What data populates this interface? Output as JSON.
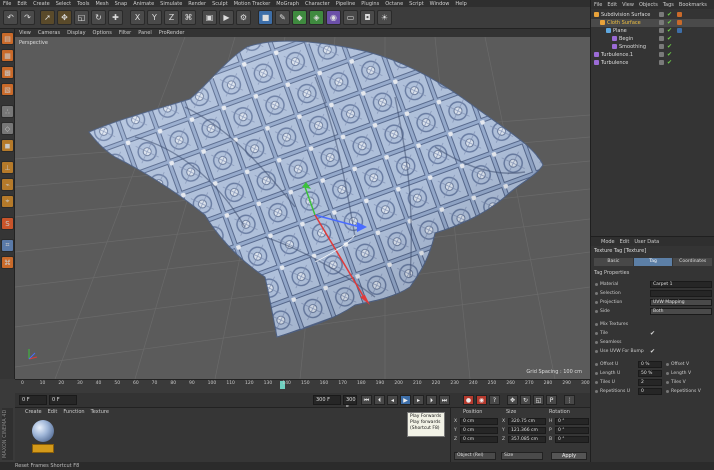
{
  "menubar": [
    "File",
    "Edit",
    "Create",
    "Select",
    "Tools",
    "Mesh",
    "Snap",
    "Animate",
    "Simulate",
    "Render",
    "Sculpt",
    "Motion Tracker",
    "MoGraph",
    "Character",
    "Pipeline",
    "Plugins",
    "Octane",
    "Script",
    "Window",
    "Help"
  ],
  "viewport_menu": [
    "View",
    "Cameras",
    "Display",
    "Options",
    "Filter",
    "Panel",
    "ProRender"
  ],
  "viewport": {
    "label": "Perspective",
    "grid_spacing": "Grid Spacing : 100 cm"
  },
  "timeline": {
    "ticks": [
      "0",
      "10",
      "20",
      "30",
      "40",
      "50",
      "60",
      "70",
      "80",
      "90",
      "100",
      "110",
      "120",
      "130",
      "140",
      "150",
      "160",
      "170",
      "180",
      "190",
      "200",
      "210",
      "220",
      "230",
      "240",
      "250",
      "260",
      "270",
      "280",
      "290",
      "300"
    ],
    "current_frame": "140",
    "end_label": "300 F"
  },
  "transport": {
    "start": "0 F",
    "current": "0 F",
    "end": "300 F",
    "end2": "300 F"
  },
  "tooltip": {
    "title": "Play Forwards",
    "line1": "Play forwards",
    "line2": "(Shortcut F8)"
  },
  "material_manager": {
    "menu": [
      "Create",
      "Edit",
      "Function",
      "Texture"
    ]
  },
  "coordinates": {
    "headers": [
      "Position",
      "Size",
      "Rotation"
    ],
    "rows": [
      {
        "axis": "X",
        "pos": "0 cm",
        "size_axis": "X",
        "size": "320.75 cm",
        "rot_axis": "H",
        "rot": "0 °"
      },
      {
        "axis": "Y",
        "pos": "0 cm",
        "size_axis": "Y",
        "size": "121.366 cm",
        "rot_axis": "P",
        "rot": "0 °"
      },
      {
        "axis": "Z",
        "pos": "0 cm",
        "size_axis": "Z",
        "size": "357.085 cm",
        "rot_axis": "B",
        "rot": "0 °"
      }
    ],
    "mode": "Object (Rel)",
    "size_mode": "Size",
    "apply": "Apply"
  },
  "object_manager": {
    "menu": [
      "File",
      "Edit",
      "View",
      "Objects",
      "Tags",
      "Bookmarks"
    ],
    "items": [
      {
        "name": "Subdivision Surface",
        "indent": 0,
        "color": "#e8a23a"
      },
      {
        "name": "Cloth Surface",
        "indent": 1,
        "color": "#e8a23a"
      },
      {
        "name": "Plane",
        "indent": 2,
        "color": "#5fa8e0"
      },
      {
        "name": "Begin",
        "indent": 3,
        "color": "#9b6bd6"
      },
      {
        "name": "Smoothing",
        "indent": 3,
        "color": "#9b6bd6"
      },
      {
        "name": "Turbulence.1",
        "indent": 0,
        "color": "#9b6bd6"
      },
      {
        "name": "Turbulence",
        "indent": 0,
        "color": "#9b6bd6"
      }
    ]
  },
  "attributes": {
    "menu": [
      "Mode",
      "Edit",
      "User Data"
    ],
    "title": "Texture Tag [Texture]",
    "tabs": [
      "Basic",
      "Tag",
      "Coordinates"
    ],
    "section": "Tag Properties",
    "rows": [
      {
        "label": "Material",
        "value": "Carpet 1"
      },
      {
        "label": "Selection",
        "value": ""
      },
      {
        "label": "Projection",
        "value": "UVW Mapping"
      },
      {
        "label": "Side",
        "value": "Both"
      }
    ],
    "checks": [
      {
        "label": "Mix Textures",
        "checked": ""
      },
      {
        "label": "Tile",
        "checked": "✔"
      },
      {
        "label": "Seamless",
        "checked": ""
      },
      {
        "label": "Use UVW For Bump",
        "checked": "✔"
      }
    ],
    "pairs": [
      {
        "l1": "Offset U",
        "v1": "0 %",
        "l2": "Offset V"
      },
      {
        "l1": "Length U",
        "v1": "50 %",
        "l2": "Length V"
      },
      {
        "l1": "Tiles U",
        "v1": "2",
        "l2": "Tiles V"
      },
      {
        "l1": "Repetitions U",
        "v1": "0",
        "l2": "Repetitions V"
      }
    ]
  },
  "statusbar": "Reset Frames Shortcut F8",
  "brand": "MAXON CINEMA 4D"
}
